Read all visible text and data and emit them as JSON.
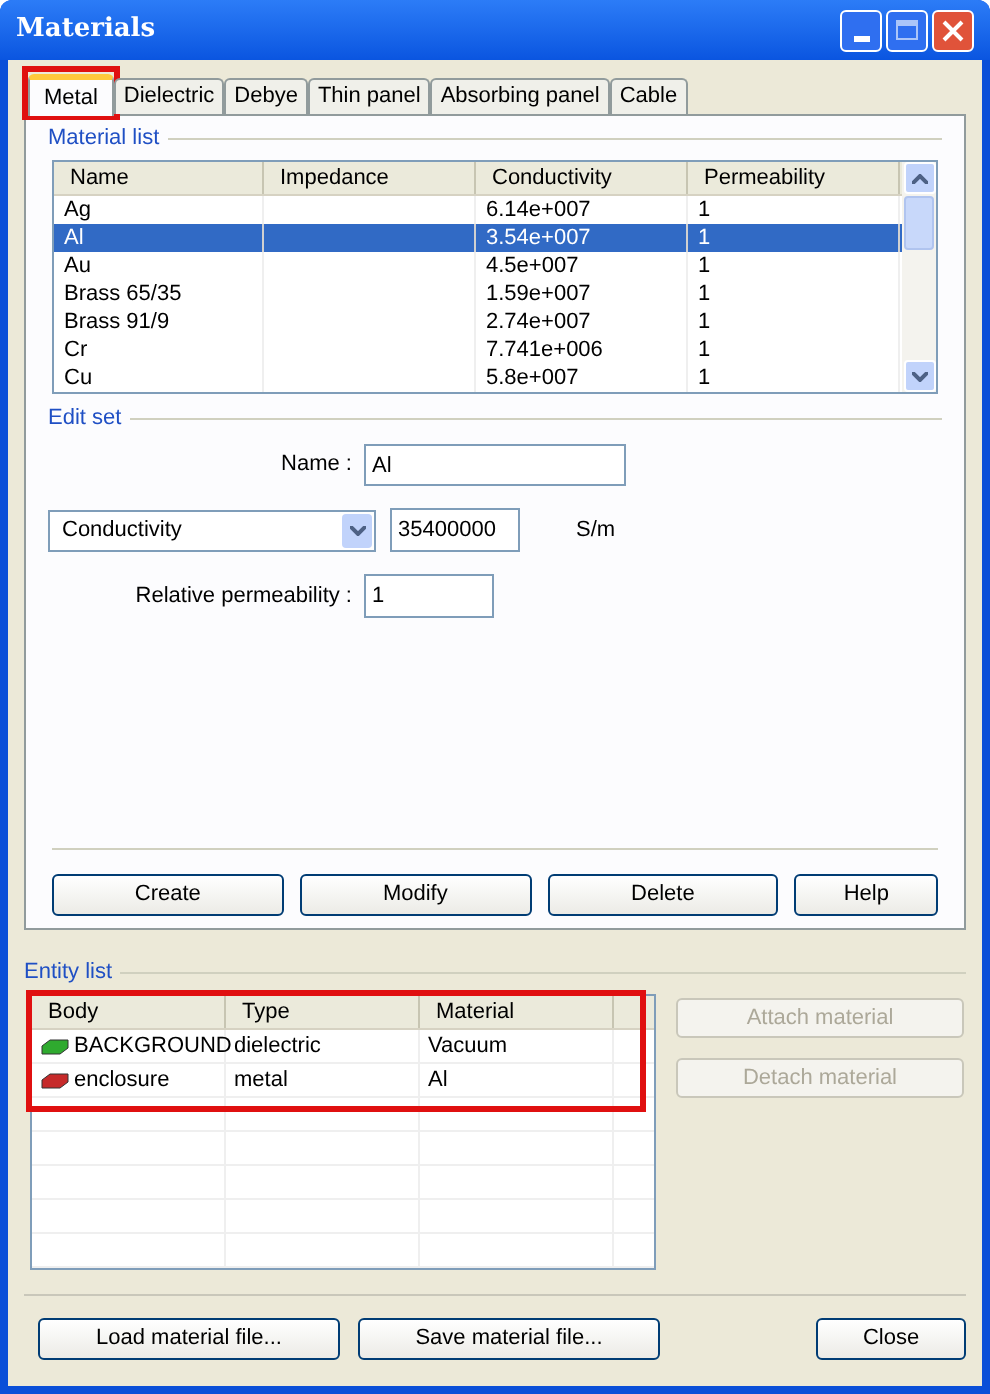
{
  "window": {
    "title": "Materials"
  },
  "tabs": [
    {
      "label": "Metal",
      "selected": true,
      "highlighted": true
    },
    {
      "label": "Dielectric",
      "selected": false,
      "highlighted": false
    },
    {
      "label": "Debye",
      "selected": false,
      "highlighted": false
    },
    {
      "label": "Thin panel",
      "selected": false,
      "highlighted": false
    },
    {
      "label": "Absorbing panel",
      "selected": false,
      "highlighted": false
    },
    {
      "label": "Cable",
      "selected": false,
      "highlighted": false
    }
  ],
  "material_list": {
    "title": "Material list",
    "columns": [
      "Name",
      "Impedance",
      "Conductivity",
      "Permeability"
    ],
    "rows": [
      {
        "cells": [
          "Ag",
          "",
          "6.14e+007",
          "1"
        ],
        "selected": false
      },
      {
        "cells": [
          "Al",
          "",
          "3.54e+007",
          "1"
        ],
        "selected": true
      },
      {
        "cells": [
          "Au",
          "",
          "4.5e+007",
          "1"
        ],
        "selected": false
      },
      {
        "cells": [
          "Brass 65/35",
          "",
          "1.59e+007",
          "1"
        ],
        "selected": false
      },
      {
        "cells": [
          "Brass 91/9",
          "",
          "2.74e+007",
          "1"
        ],
        "selected": false
      },
      {
        "cells": [
          "Cr",
          "",
          "7.741e+006",
          "1"
        ],
        "selected": false
      },
      {
        "cells": [
          "Cu",
          "",
          "5.8e+007",
          "1"
        ],
        "selected": false
      }
    ]
  },
  "edit_set": {
    "title": "Edit set",
    "name_label": "Name :",
    "name_value": "Al",
    "property_select": "Conductivity",
    "property_value": "35400000",
    "unit": "S/m",
    "permeability_label": "Relative permeability :",
    "permeability_value": "1",
    "buttons": [
      "Create",
      "Modify",
      "Delete",
      "Help"
    ]
  },
  "entity_list": {
    "title": "Entity list",
    "highlighted": true,
    "columns": [
      "Body",
      "Type",
      "Material"
    ],
    "rows": [
      {
        "cells": [
          "BACKGROUND",
          "dielectric",
          "Vacuum"
        ],
        "color": "#2faa2f"
      },
      {
        "cells": [
          "enclosure",
          "metal",
          "Al"
        ],
        "color": "#c62a2a"
      }
    ],
    "actions": [
      {
        "label": "Attach material",
        "disabled": true
      },
      {
        "label": "Detach material",
        "disabled": true
      }
    ]
  },
  "footer_buttons": [
    "Load material file...",
    "Save material file...",
    "Close"
  ]
}
